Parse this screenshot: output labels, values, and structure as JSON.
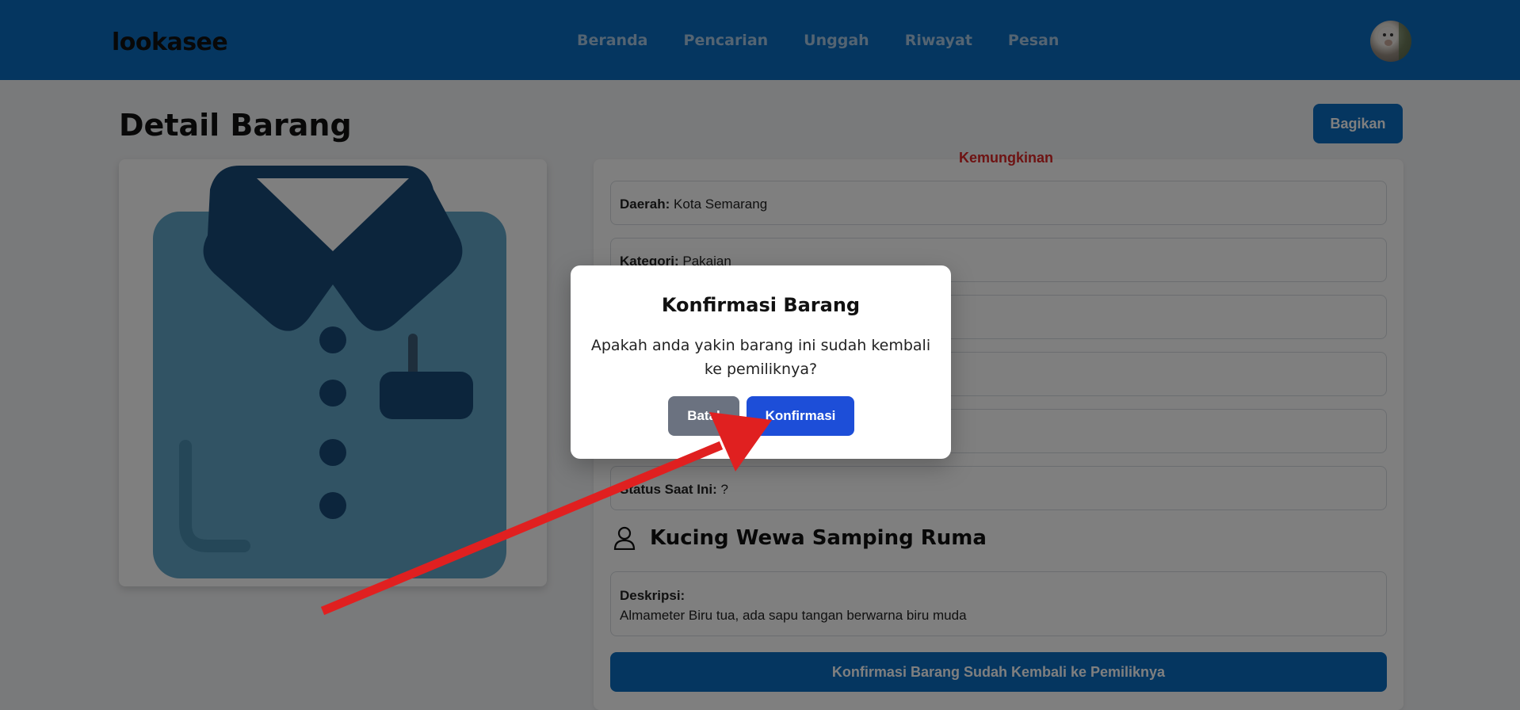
{
  "header": {
    "logo": "lookasee",
    "nav": [
      "Beranda",
      "Pencarian",
      "Unggah",
      "Riwayat",
      "Pesan"
    ]
  },
  "page": {
    "title": "Detail Barang",
    "share_label": "Bagikan"
  },
  "details": {
    "status_top": "Kemungkinan",
    "fields": [
      {
        "label": "Daerah:",
        "value": "Kota Semarang"
      },
      {
        "label": "Kategori:",
        "value": "Pakaian"
      },
      {
        "label": "",
        "value": ""
      },
      {
        "label": "",
        "value": ""
      },
      {
        "label": "",
        "value": ""
      },
      {
        "label": "Status Saat Ini:",
        "value": "?"
      }
    ],
    "owner_name": "Kucing Wewa Samping Ruma",
    "description_label": "Deskripsi:",
    "description": "Almameter Biru tua, ada sapu tangan berwarna biru muda",
    "confirm_button": "Konfirmasi Barang Sudah Kembali ke Pemiliknya"
  },
  "modal": {
    "title": "Konfirmasi Barang",
    "message": "Apakah anda yakin barang ini sudah kembali ke pemiliknya?",
    "cancel_label": "Batal",
    "confirm_label": "Konfirmasi"
  },
  "colors": {
    "header": "#0a6cc0",
    "confirm": "#1d4ed8",
    "cancel": "#6b7280",
    "arrow": "#e02020"
  },
  "icons": {
    "avatar": "cat-avatar",
    "owner": "user-icon",
    "item": "shirt-illustration"
  }
}
